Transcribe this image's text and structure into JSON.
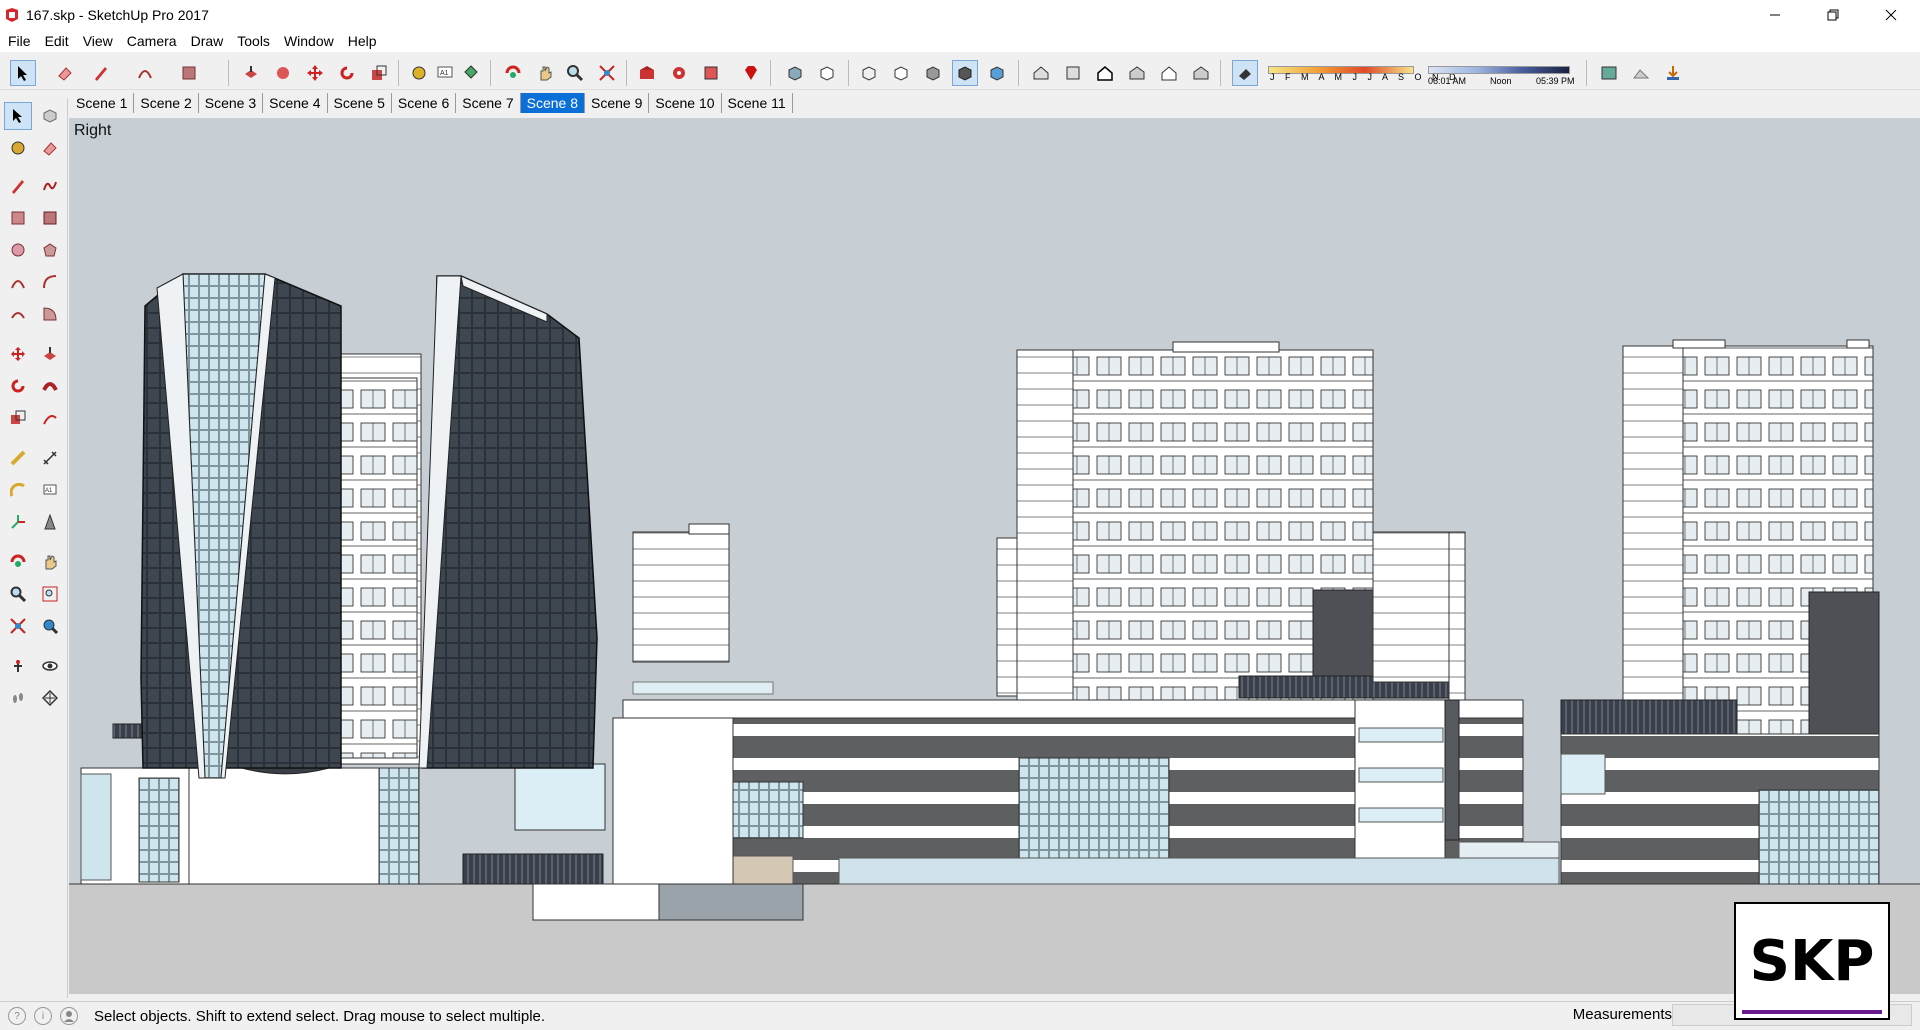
{
  "window": {
    "title": "167.skp - SketchUp Pro 2017"
  },
  "menu": [
    "File",
    "Edit",
    "View",
    "Camera",
    "Draw",
    "Tools",
    "Window",
    "Help"
  ],
  "scenes": {
    "tabs": [
      "Scene 1",
      "Scene 2",
      "Scene 3",
      "Scene 4",
      "Scene 5",
      "Scene 6",
      "Scene 7",
      "Scene 8",
      "Scene 9",
      "Scene 10",
      "Scene 11"
    ],
    "active": "Scene 8"
  },
  "shadow_settings": {
    "months": "J F M A M J J A S O N D",
    "time_start": "06:01 AM",
    "time_mid": "Noon",
    "time_end": "05:39 PM"
  },
  "viewport": {
    "view_name": "Right"
  },
  "status": {
    "hint": "Select objects. Shift to extend select. Drag mouse to select multiple.",
    "measurements_label": "Measurements",
    "measurements_value": ""
  },
  "badge": {
    "text": "SKP"
  },
  "colors": {
    "sky": "#c7cfd4",
    "ground": "#c9c9c9",
    "active_tab": "#0a6fd6",
    "tower_glass": "#2b3138"
  }
}
